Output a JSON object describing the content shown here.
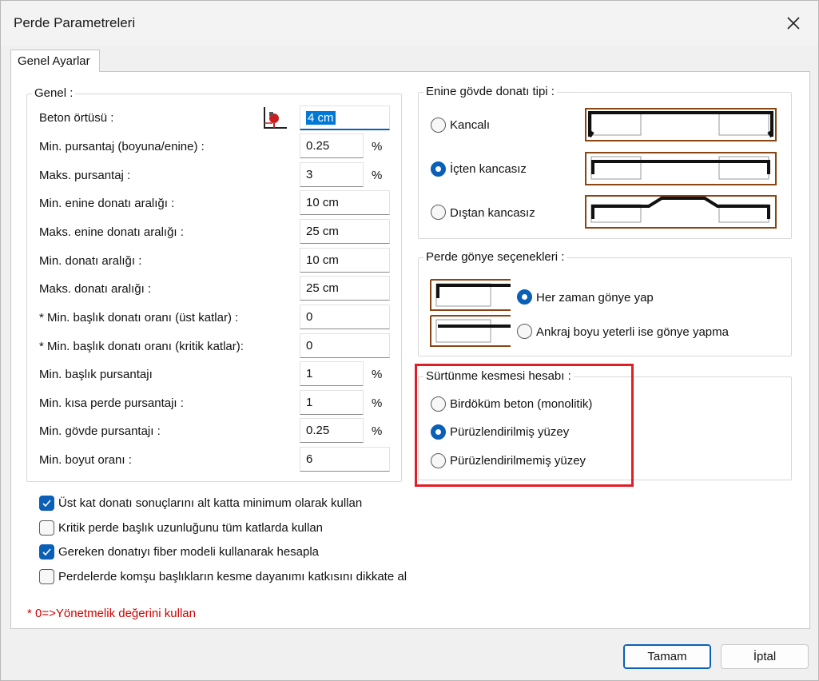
{
  "window": {
    "title": "Perde Parametreleri"
  },
  "tabs": [
    {
      "label": "Genel Ayarlar"
    }
  ],
  "general": {
    "title": "Genel :",
    "rows": [
      {
        "label": "Beton örtüsü :",
        "value": "4 cm",
        "unit": ""
      },
      {
        "label": "Min. pursantaj (boyuna/enine) :",
        "value": "0.25",
        "unit": "%"
      },
      {
        "label": "Maks. pursantaj :",
        "value": "3",
        "unit": "%"
      },
      {
        "label": "Min. enine donatı aralığı :",
        "value": "10 cm",
        "unit": ""
      },
      {
        "label": "Maks. enine donatı aralığı :",
        "value": "25 cm",
        "unit": ""
      },
      {
        "label": "Min. donatı aralığı :",
        "value": "10 cm",
        "unit": ""
      },
      {
        "label": "Maks. donatı aralığı :",
        "value": "25 cm",
        "unit": ""
      },
      {
        "label": "* Min. başlık donatı oranı (üst katlar) :",
        "value": "0",
        "unit": ""
      },
      {
        "label": "* Min. başlık donatı oranı (kritik katlar):",
        "value": "0",
        "unit": ""
      },
      {
        "label": "Min. başlık pursantajı",
        "value": "1",
        "unit": "%"
      },
      {
        "label": "Min. kısa perde pursantajı :",
        "value": "1",
        "unit": "%"
      },
      {
        "label": "Min. gövde pursantajı :",
        "value": "0.25",
        "unit": "%"
      },
      {
        "label": "Min. boyut oranı :",
        "value": "6",
        "unit": ""
      }
    ]
  },
  "transverse": {
    "title": "Enine gövde donatı tipi :",
    "options": [
      {
        "label": "Kancalı",
        "checked": false
      },
      {
        "label": "İçten kancasız",
        "checked": true
      },
      {
        "label": "Dıştan kancasız",
        "checked": false
      }
    ]
  },
  "corner": {
    "title": "Perde gönye seçenekleri :",
    "options": [
      {
        "label": "Her zaman gönye yap",
        "checked": true
      },
      {
        "label": "Ankraj boyu yeterli ise gönye yapma",
        "checked": false
      }
    ]
  },
  "friction": {
    "title": "Sürtünme kesmesi hesabı :",
    "options": [
      {
        "label": "Birdöküm beton (monolitik)",
        "checked": false
      },
      {
        "label": "Pürüzlendirilmiş yüzey",
        "checked": true
      },
      {
        "label": "Pürüzlendirilmemiş yüzey",
        "checked": false
      }
    ]
  },
  "checkboxes": [
    {
      "label": "Üst kat donatı sonuçlarını alt katta minimum olarak kullan",
      "checked": true
    },
    {
      "label": "Kritik perde başlık uzunluğunu tüm katlarda kullan",
      "checked": false
    },
    {
      "label": "Gereken donatıyı fiber modeli kullanarak hesapla",
      "checked": true
    },
    {
      "label": "Perdelerde komşu başlıkların kesme dayanımı katkısını dikkate al",
      "checked": false
    }
  ],
  "note": "* 0=>Yönetmelik değerini kullan",
  "buttons": {
    "ok": "Tamam",
    "cancel": "İptal"
  },
  "colors": {
    "accent": "#0a5fb6",
    "highlight": "#e01e26",
    "note": "#d00000",
    "rebar_frame": "#8b4513"
  },
  "icons": {
    "close": "close-icon",
    "cover": "concrete-cover-icon"
  }
}
